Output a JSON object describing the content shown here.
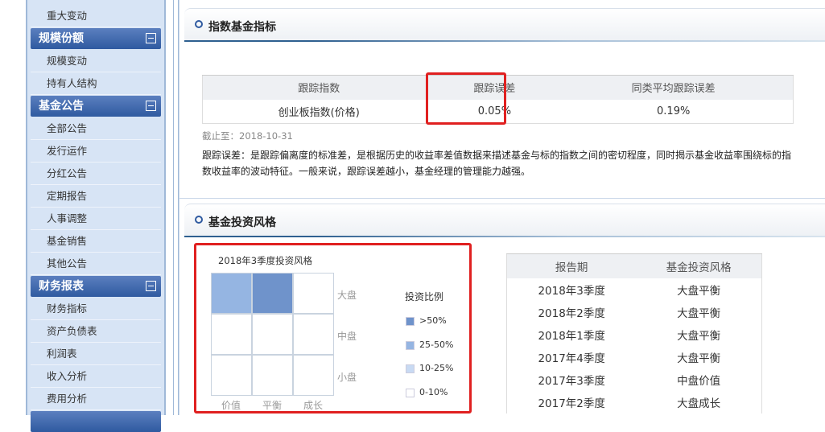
{
  "sidebar": {
    "top_item": "重大变动",
    "groups": [
      {
        "title": "规模份额",
        "items": [
          "规模变动",
          "持有人结构"
        ]
      },
      {
        "title": "基金公告",
        "items": [
          "全部公告",
          "发行运作",
          "分红公告",
          "定期报告",
          "人事调整",
          "基金销售",
          "其他公告"
        ]
      },
      {
        "title": "财务报表",
        "items": [
          "财务指标",
          "资产负债表",
          "利润表",
          "收入分析",
          "费用分析"
        ]
      }
    ]
  },
  "index": {
    "title": "指数基金指标",
    "headers": [
      "跟踪指数",
      "跟踪误差",
      "同类平均跟踪误差"
    ],
    "row": [
      "创业板指数(价格)",
      "0.05%",
      "0.19%"
    ],
    "date": "截止至：2018-10-31",
    "note": "跟踪误差：是跟踪偏离度的标准差，是根据历史的收益率差值数据来描述基金与标的指数之间的密切程度，同时揭示基金收益率围绕标的指数收益率的波动特征。一般来说，跟踪误差越小，基金经理的管理能力越强。"
  },
  "style": {
    "title": "基金投资风格",
    "chart_data": {
      "type": "heatmap",
      "title": "2018年3季度投资风格",
      "columns": [
        "价值",
        "平衡",
        "成长"
      ],
      "rows": [
        "大盘",
        "中盘",
        "小盘"
      ],
      "levels": [
        [
          "25-50%",
          ">50%",
          "0-10%"
        ],
        [
          "0-10%",
          "0-10%",
          "0-10%"
        ],
        [
          "0-10%",
          "0-10%",
          "0-10%"
        ]
      ],
      "legend_title": "投资比例",
      "legend": [
        {
          "label": ">50%",
          "color": "#6f93cb"
        },
        {
          "label": "25-50%",
          "color": "#95b5e2"
        },
        {
          "label": "10-25%",
          "color": "#c8daf3"
        },
        {
          "label": "0-10%",
          "color": "#ffffff"
        }
      ]
    },
    "table": {
      "headers": [
        "报告期",
        "基金投资风格"
      ],
      "rows": [
        [
          "2018年3季度",
          "大盘平衡"
        ],
        [
          "2018年2季度",
          "大盘平衡"
        ],
        [
          "2018年1季度",
          "大盘平衡"
        ],
        [
          "2017年4季度",
          "大盘平衡"
        ],
        [
          "2017年3季度",
          "中盘价值"
        ],
        [
          "2017年2季度",
          "大盘成长"
        ]
      ]
    }
  }
}
